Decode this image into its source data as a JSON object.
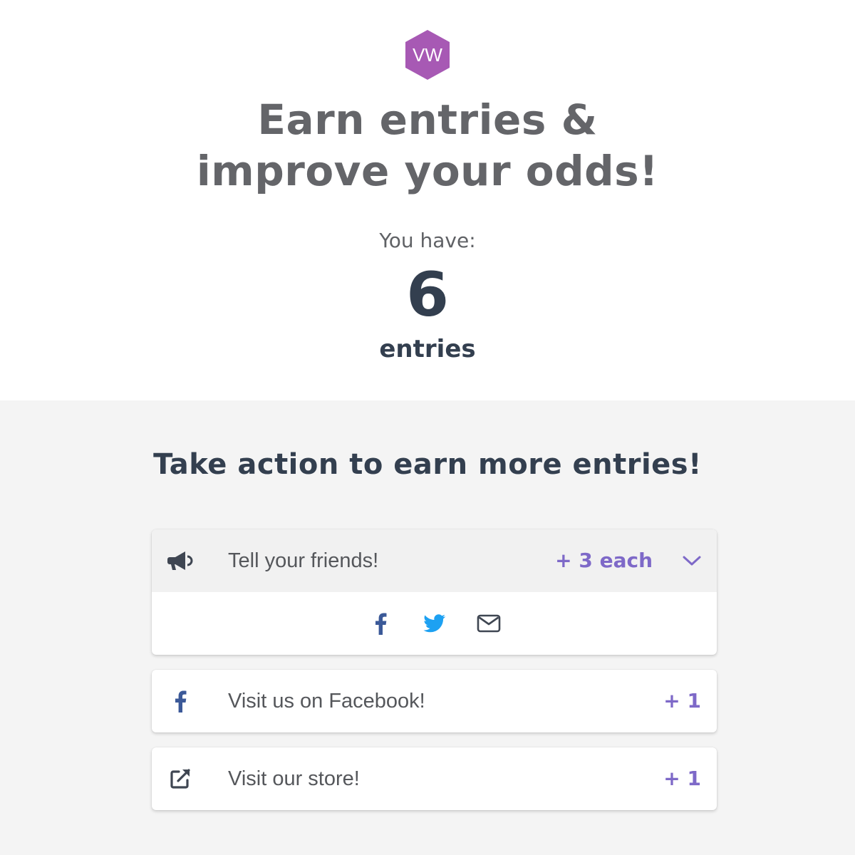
{
  "brand": {
    "logo_text": "VW",
    "logo_color": "#a759b4"
  },
  "header": {
    "headline_line1": "Earn entries &",
    "headline_line2": "improve your odds!",
    "you_have_label": "You have:",
    "entry_count": "6",
    "entries_label": "entries"
  },
  "actions": {
    "heading": "Take action to earn more entries!",
    "items": [
      {
        "icon": "megaphone-icon",
        "label": "Tell your friends!",
        "points": "+ 3 each",
        "expanded": true,
        "share_options": [
          "facebook-icon",
          "twitter-icon",
          "email-icon"
        ]
      },
      {
        "icon": "facebook-icon",
        "label": "Visit us on Facebook!",
        "points": "+ 1"
      },
      {
        "icon": "external-link-icon",
        "label": "Visit our store!",
        "points": "+ 1"
      }
    ]
  },
  "colors": {
    "accent": "#7e69c8",
    "facebook": "#3b5998",
    "twitter": "#1da1f2",
    "heading": "#333f4f"
  }
}
